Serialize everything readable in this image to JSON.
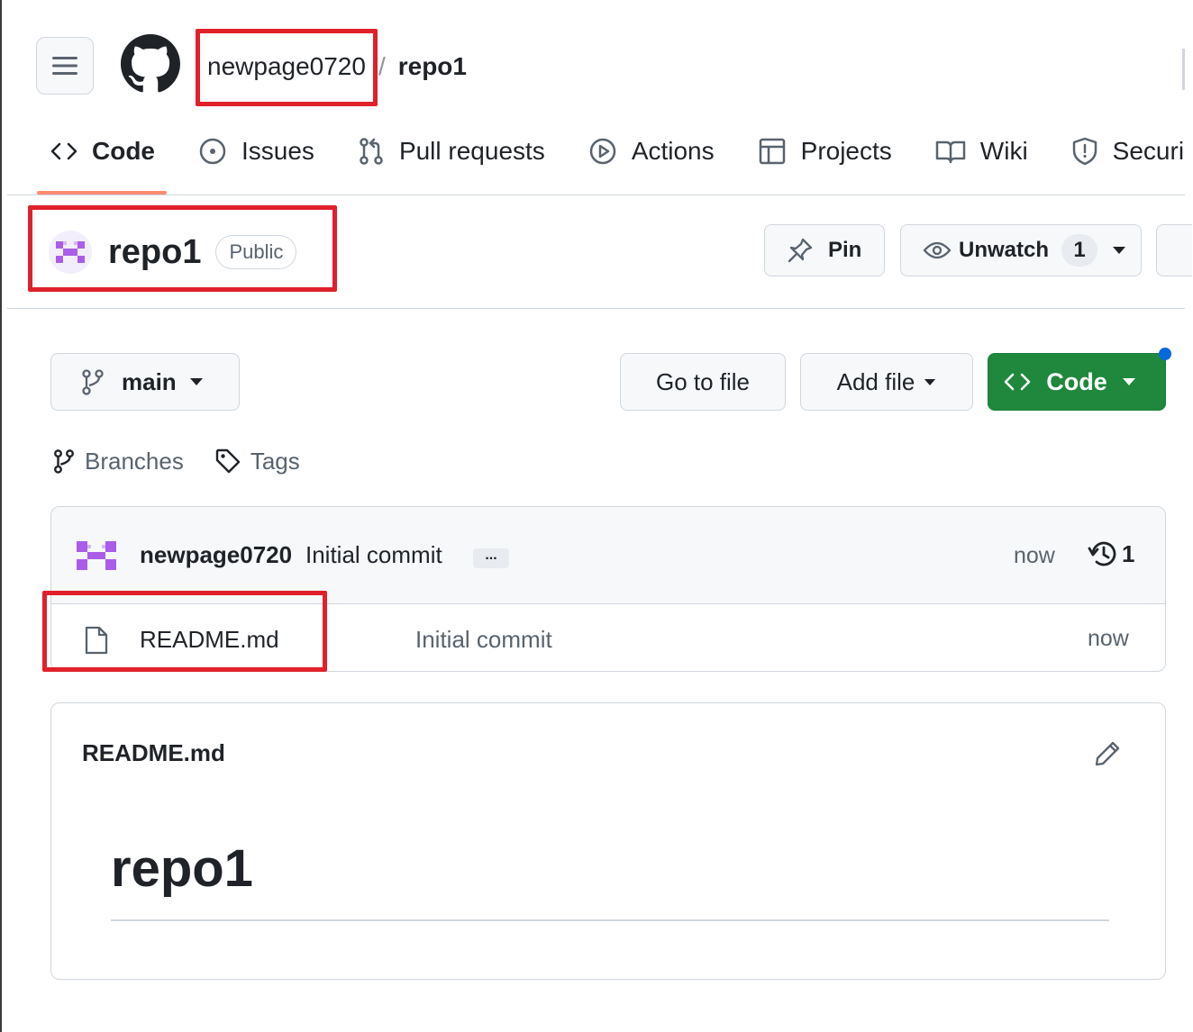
{
  "header": {
    "owner": "newpage0720",
    "separator": "/",
    "repo": "repo1"
  },
  "tabs": [
    {
      "label": "Code",
      "icon": "code-icon",
      "active": true
    },
    {
      "label": "Issues",
      "icon": "issue-icon",
      "active": false
    },
    {
      "label": "Pull requests",
      "icon": "pull-request-icon",
      "active": false
    },
    {
      "label": "Actions",
      "icon": "play-icon",
      "active": false
    },
    {
      "label": "Projects",
      "icon": "table-icon",
      "active": false
    },
    {
      "label": "Wiki",
      "icon": "book-icon",
      "active": false
    },
    {
      "label": "Securi",
      "icon": "shield-icon",
      "active": false
    }
  ],
  "repo_header": {
    "name": "repo1",
    "visibility": "Public",
    "pin_label": "Pin",
    "watch_label": "Unwatch",
    "watch_count": "1"
  },
  "toolbar": {
    "branch": "main",
    "go_to_file": "Go to file",
    "add_file": "Add file",
    "code": "Code"
  },
  "meta": {
    "branches": "Branches",
    "tags": "Tags"
  },
  "latest_commit": {
    "author": "newpage0720",
    "message": "Initial commit",
    "ellipsis": "...",
    "time": "now",
    "count": "1"
  },
  "files": [
    {
      "name": "README.md",
      "message": "Initial commit",
      "time": "now"
    }
  ],
  "readme": {
    "title": "README.md",
    "heading": "repo1"
  },
  "colors": {
    "primary_button": "#1f883d",
    "active_tab_underline": "#fd8c73",
    "highlight": "#e0202a",
    "notification_dot": "#0969da"
  }
}
